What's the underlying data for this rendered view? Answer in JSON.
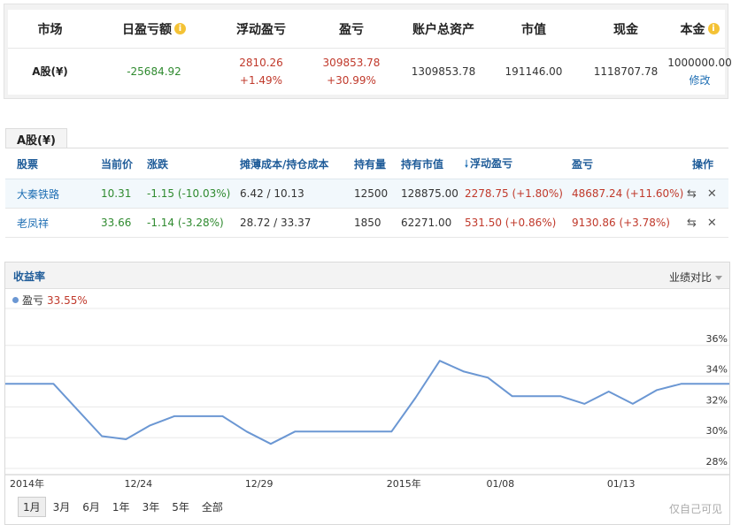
{
  "summary": {
    "headers": {
      "market": "市场",
      "daily_pl": "日盈亏额",
      "floating_pl": "浮动盈亏",
      "pl": "盈亏",
      "total_assets": "账户总资产",
      "market_value": "市值",
      "cash": "现金",
      "principal": "本金"
    },
    "row": {
      "market": "A股(¥)",
      "daily_pl": "-25684.92",
      "floating_pl": "2810.26",
      "floating_pl_pct": "+1.49%",
      "pl": "309853.78",
      "pl_pct": "+30.99%",
      "total_assets": "1309853.78",
      "market_value": "191146.00",
      "cash": "1118707.78",
      "principal": "1000000.00",
      "edit": "修改"
    },
    "info_glyph": "i"
  },
  "holdings": {
    "tab_label": "A股(¥)",
    "headers": {
      "stock": "股票",
      "price": "当前价",
      "change": "涨跌",
      "cost": "摊薄成本/持仓成本",
      "qty": "持有量",
      "value": "持有市值",
      "floating": "浮动盈亏",
      "pl": "盈亏",
      "ops": "操作"
    },
    "rows": [
      {
        "name": "大秦铁路",
        "price": "10.31",
        "change": "-1.15 (-10.03%)",
        "cost": "6.42 / 10.13",
        "qty": "12500",
        "value": "128875.00",
        "floating": "2278.75 (+1.80%)",
        "pl": "48687.24 (+11.60%)"
      },
      {
        "name": "老凤祥",
        "price": "33.66",
        "change": "-1.14 (-3.28%)",
        "cost": "28.72 / 33.37",
        "qty": "1850",
        "value": "62271.00",
        "floating": "531.50 (+0.86%)",
        "pl": "9130.86 (+3.78%)"
      }
    ],
    "icons": {
      "sort": "sort-down-icon",
      "transfer": "transfer-icon",
      "delete": "close-icon"
    }
  },
  "chart": {
    "title": "收益率",
    "compare_label": "业绩对比",
    "legend_name": "盈亏",
    "legend_value": "33.55%",
    "ranges": [
      "1月",
      "3月",
      "6月",
      "1年",
      "3年",
      "5年",
      "全部"
    ],
    "active_range": "1月",
    "private_note": "仅自己可见"
  },
  "chart_data": {
    "type": "line",
    "series": [
      {
        "name": "盈亏",
        "color": "#6b97d3",
        "values": [
          33.5,
          33.5,
          33.5,
          31.8,
          30.1,
          29.9,
          30.8,
          31.4,
          31.4,
          31.4,
          30.4,
          29.6,
          30.4,
          30.4,
          30.4,
          30.4,
          30.4,
          32.6,
          35.0,
          34.3,
          33.9,
          32.7,
          32.7,
          32.7,
          32.2,
          33.0,
          32.2,
          33.1,
          33.5,
          33.5,
          33.5
        ]
      }
    ],
    "x_tick_labels": [
      "2014年",
      "12/24",
      "12/29",
      "2015年",
      "01/08",
      "01/13"
    ],
    "y_ticks": [
      28,
      30,
      32,
      34,
      36
    ],
    "y_tick_labels": [
      "28%",
      "30%",
      "32%",
      "34%",
      "36%"
    ],
    "ylim": [
      27.6,
      38.4
    ],
    "grid": true,
    "line_color": "#6b97d3",
    "grid_color": "#e8e8e8",
    "axis_color": "#c8c8c8"
  }
}
